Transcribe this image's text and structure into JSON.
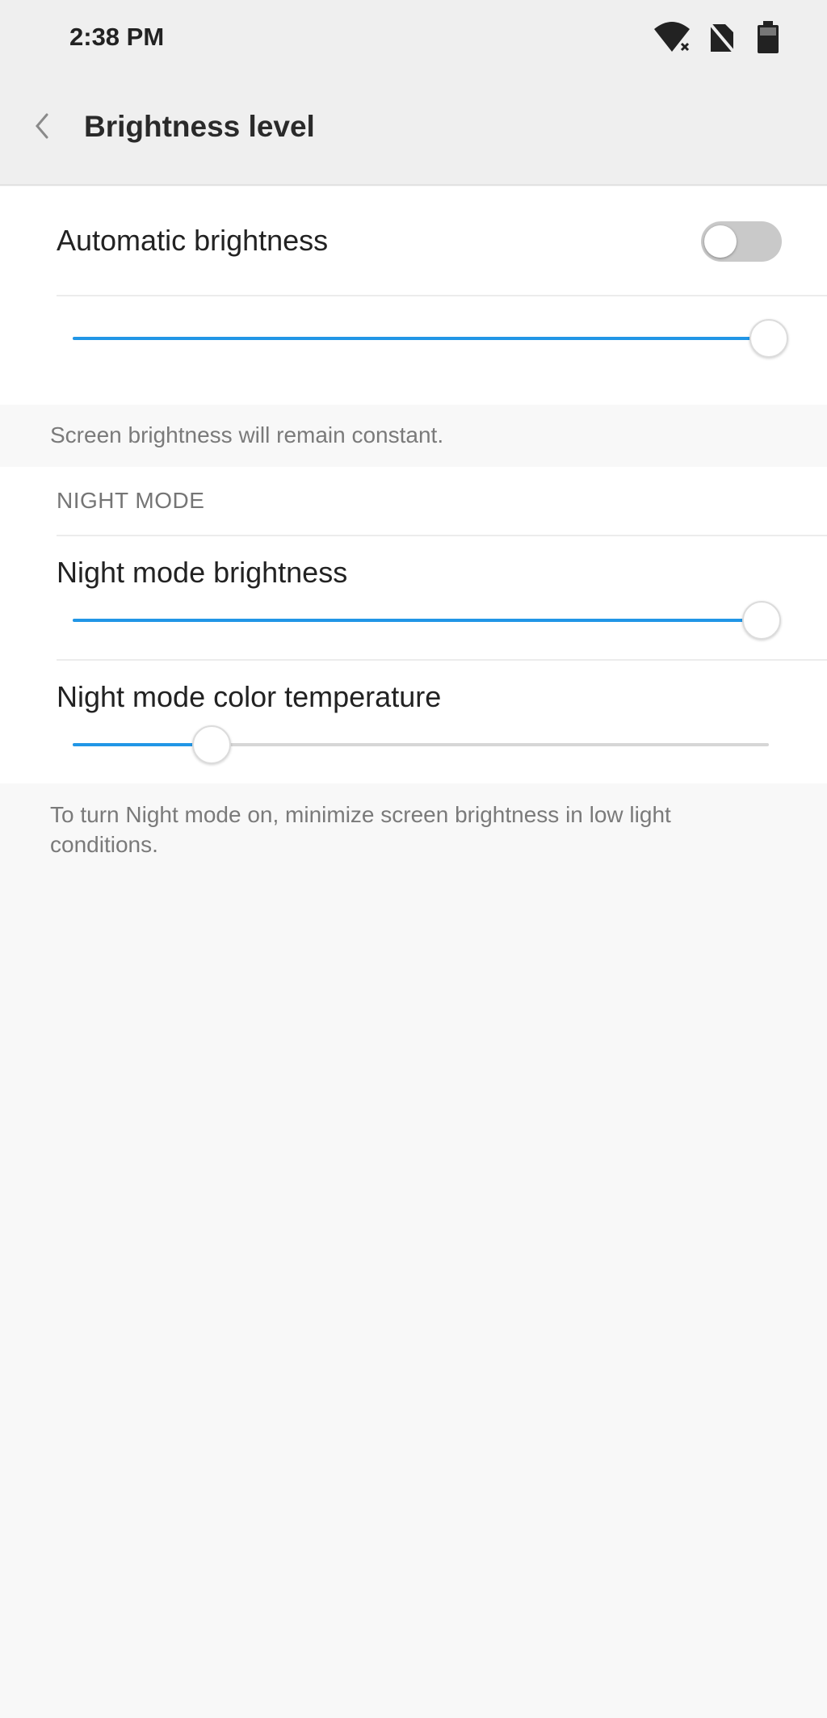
{
  "status_bar": {
    "time": "2:38 PM",
    "icons": [
      "wifi-icon",
      "no-sim-icon",
      "battery-icon"
    ]
  },
  "app_bar": {
    "back_icon": "chevron-left-icon",
    "title": "Brightness level"
  },
  "brightness": {
    "auto_label": "Automatic brightness",
    "auto_enabled": false,
    "level_fraction": 1.0,
    "note": "Screen brightness will remain constant."
  },
  "night_mode": {
    "header": "NIGHT MODE",
    "brightness_label": "Night mode brightness",
    "brightness_fraction": 0.99,
    "color_temp_label": "Night mode color temperature",
    "color_temp_fraction": 0.2,
    "note": "To turn Night mode on, minimize screen brightness in low light conditions."
  },
  "colors": {
    "accent": "#2196e6",
    "track": "#d6d6d6",
    "toggle_off": "#c9c9c9",
    "background": "#f8f8f8",
    "bar": "#efefef"
  }
}
